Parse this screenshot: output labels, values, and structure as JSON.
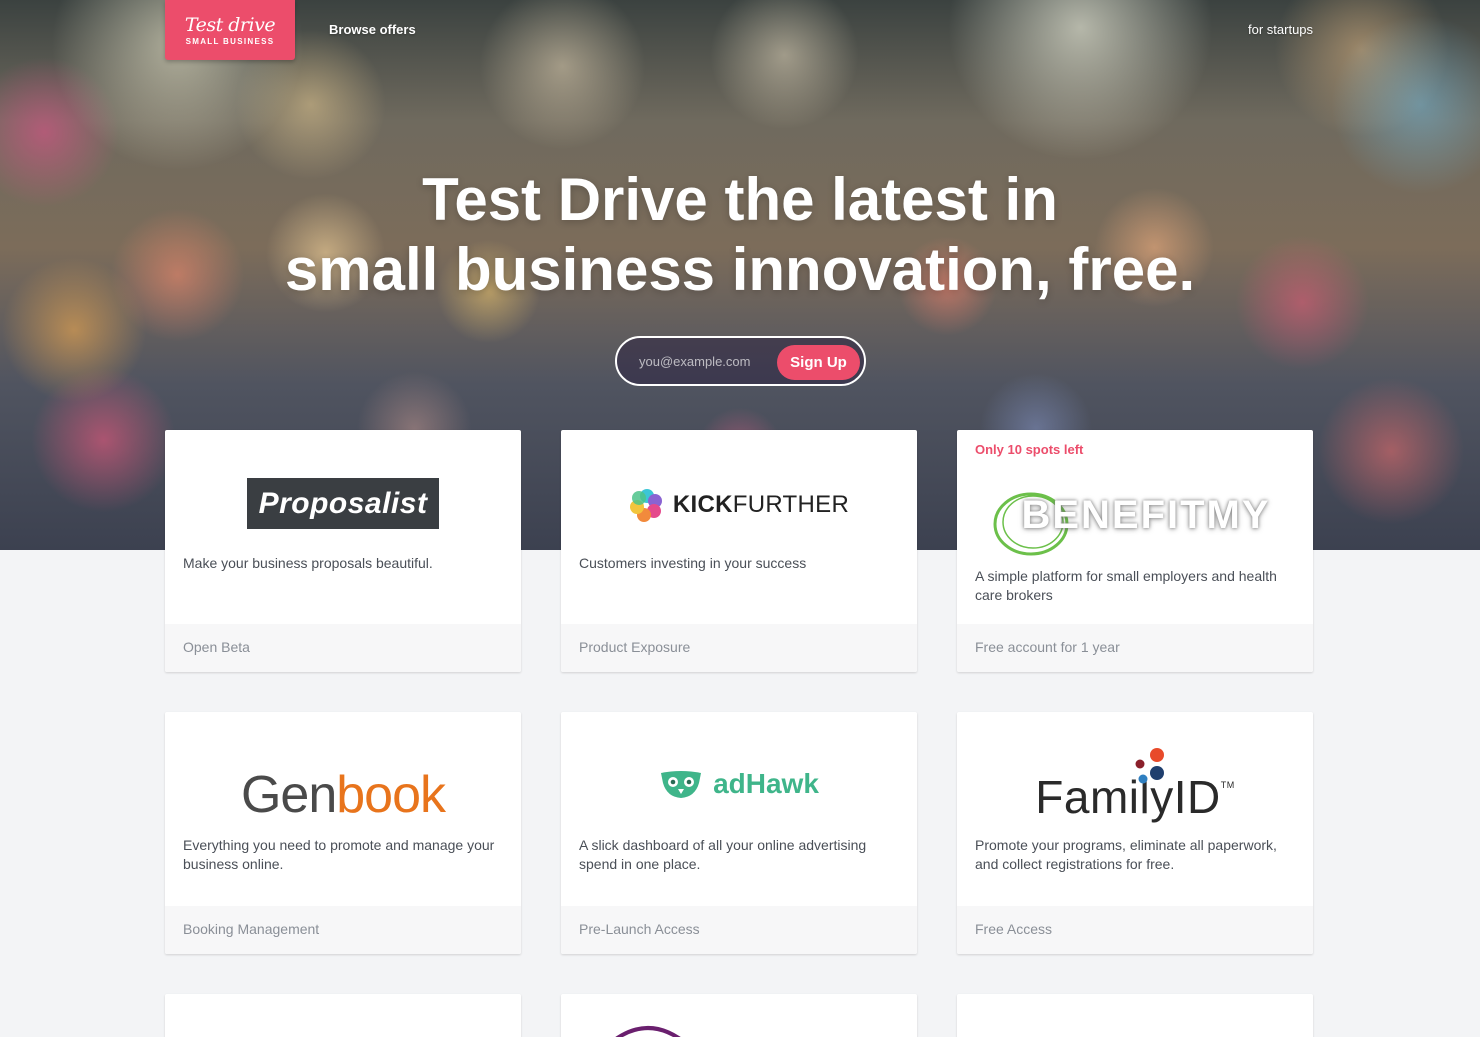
{
  "nav": {
    "logo_script": "Test drive",
    "logo_sub": "SMALL BUSINESS",
    "browse": "Browse offers",
    "startups": "for startups"
  },
  "hero": {
    "line1": "Test Drive the latest in",
    "line2": "small business innovation, free.",
    "email_placeholder": "you@example.com",
    "signup_label": "Sign Up"
  },
  "colors": {
    "accent": "#ec4d6b",
    "card_bg": "#ffffff",
    "footer_bg": "#f7f7f8",
    "page_bg": "#f3f4f6"
  },
  "offers": [
    {
      "logo_text": "Proposalist",
      "description": "Make your business proposals beautiful.",
      "perk": "Open Beta"
    },
    {
      "logo_text_bold": "KICK",
      "logo_text_light": "FURTHER",
      "logo_icon": "kickfurther-flower-icon",
      "description": "Customers investing in your success",
      "perk": "Product Exposure"
    },
    {
      "badge": "Only 10 spots left",
      "logo_text": "BENEFITMY",
      "description": "A simple platform for small employers and health care brokers",
      "perk": "Free account for 1 year"
    },
    {
      "logo_text_a": "Gen",
      "logo_text_b": "book",
      "description": "Everything you need to promote and manage your business online.",
      "perk": "Booking Management"
    },
    {
      "logo_text": "adHawk",
      "logo_icon": "owl-icon",
      "description": "A slick dashboard of all your online advertising spend in one place.",
      "perk": "Pre-Launch Access"
    },
    {
      "logo_text": "FamilyID",
      "logo_tm": "TM",
      "logo_icon": "dots-icon",
      "description": "Promote your programs, eliminate all paperwork, and collect registrations for free.",
      "perk": "Free Access"
    }
  ]
}
